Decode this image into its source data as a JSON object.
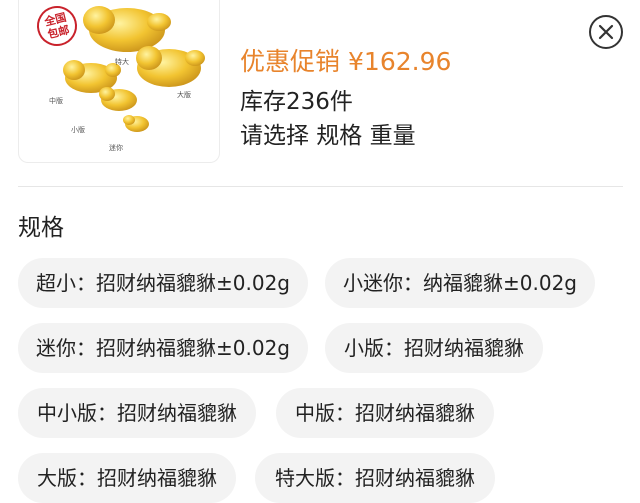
{
  "product": {
    "stamp_text": "全国包邮",
    "size_tags": [
      "特大",
      "大版",
      "中版",
      "小版",
      "迷你"
    ]
  },
  "header": {
    "promo_label": "优惠促销",
    "price": "¥162.96",
    "stock": "库存236件",
    "select_prompt": "请选择 规格 重量"
  },
  "specs": {
    "title": "规格",
    "options": [
      "超小：招财纳福貔貅±0.02g",
      "小迷你：纳福貔貅±0.02g",
      "迷你：招财纳福貔貅±0.02g",
      "小版：招财纳福貔貅",
      "中小版：招财纳福貔貅",
      "中版：招财纳福貔貅",
      "大版：招财纳福貔貅",
      "特大版：招财纳福貔貅"
    ]
  },
  "colors": {
    "accent": "#e8842c",
    "chip_bg": "#f3f3f3",
    "gold": "#f2c431"
  }
}
